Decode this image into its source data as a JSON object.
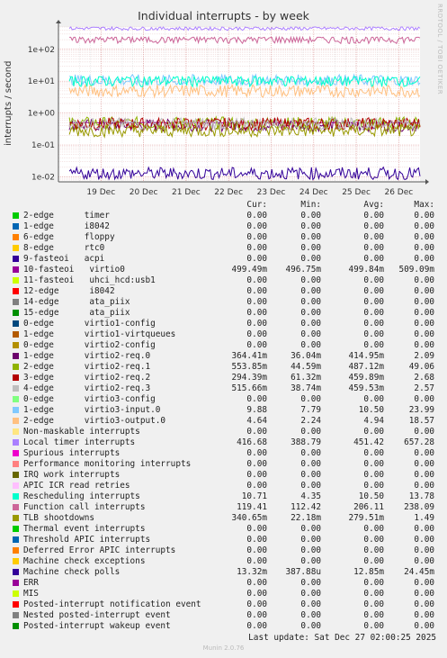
{
  "title": "Individual interrupts - by week",
  "side_text": "RRDTOOL / TOBI OETIKER",
  "footer": "Last update: Sat Dec 27 02:00:25 2025",
  "munin_version": "Munin 2.0.76",
  "legend_headers": {
    "cur": "Cur:",
    "min": "Min:",
    "avg": "Avg:",
    "max": "Max:"
  },
  "chart_data": {
    "type": "line",
    "ylabel": "interrupts / second",
    "yscale": "log",
    "ylim": [
      0.007,
      500
    ],
    "y_ticks": [
      "1e-02",
      "1e-01",
      "1e+00",
      "1e+01",
      "1e+02"
    ],
    "x_ticks": [
      "19 Dec",
      "20 Dec",
      "21 Dec",
      "22 Dec",
      "23 Dec",
      "24 Dec",
      "25 Dec",
      "26 Dec"
    ],
    "grid": true,
    "series": [
      {
        "name": "2-edge      timer",
        "color": "#00cc00",
        "cur": "0.00",
        "min": "0.00",
        "avg": "0.00",
        "max": "0.00"
      },
      {
        "name": "1-edge      i8042",
        "color": "#0066b3",
        "cur": "0.00",
        "min": "0.00",
        "avg": "0.00",
        "max": "0.00"
      },
      {
        "name": "6-edge      floppy",
        "color": "#ff8000",
        "cur": "0.00",
        "min": "0.00",
        "avg": "0.00",
        "max": "0.00"
      },
      {
        "name": "8-edge      rtc0",
        "color": "#ffcc00",
        "cur": "0.00",
        "min": "0.00",
        "avg": "0.00",
        "max": "0.00"
      },
      {
        "name": "9-fasteoi   acpi",
        "color": "#330099",
        "cur": "0.00",
        "min": "0.00",
        "avg": "0.00",
        "max": "0.00"
      },
      {
        "name": "10-fasteoi   virtio0",
        "color": "#990099",
        "cur": "499.49m",
        "min": "496.75m",
        "avg": "499.84m",
        "max": "509.09m"
      },
      {
        "name": "11-fasteoi   uhci_hcd:usb1",
        "color": "#ccff00",
        "cur": "0.00",
        "min": "0.00",
        "avg": "0.00",
        "max": "0.00"
      },
      {
        "name": "12-edge      i8042",
        "color": "#ff0000",
        "cur": "0.00",
        "min": "0.00",
        "avg": "0.00",
        "max": "0.00"
      },
      {
        "name": "14-edge      ata_piix",
        "color": "#808080",
        "cur": "0.00",
        "min": "0.00",
        "avg": "0.00",
        "max": "0.00"
      },
      {
        "name": "15-edge      ata_piix",
        "color": "#008f00",
        "cur": "0.00",
        "min": "0.00",
        "avg": "0.00",
        "max": "0.00"
      },
      {
        "name": "0-edge      virtio1-config",
        "color": "#00487d",
        "cur": "0.00",
        "min": "0.00",
        "avg": "0.00",
        "max": "0.00"
      },
      {
        "name": "1-edge      virtio1-virtqueues",
        "color": "#b35a00",
        "cur": "0.00",
        "min": "0.00",
        "avg": "0.00",
        "max": "0.00"
      },
      {
        "name": "0-edge      virtio2-config",
        "color": "#b38f00",
        "cur": "0.00",
        "min": "0.00",
        "avg": "0.00",
        "max": "0.00"
      },
      {
        "name": "1-edge      virtio2-req.0",
        "color": "#6b006b",
        "cur": "364.41m",
        "min": "36.04m",
        "avg": "414.95m",
        "max": "2.09"
      },
      {
        "name": "2-edge      virtio2-req.1",
        "color": "#8fb300",
        "cur": "553.85m",
        "min": "44.59m",
        "avg": "487.12m",
        "max": "49.06"
      },
      {
        "name": "3-edge      virtio2-req.2",
        "color": "#b30000",
        "cur": "294.39m",
        "min": "61.32m",
        "avg": "459.89m",
        "max": "2.68"
      },
      {
        "name": "4-edge      virtio2-req.3",
        "color": "#bebebe",
        "cur": "515.66m",
        "min": "38.74m",
        "avg": "459.53m",
        "max": "2.57"
      },
      {
        "name": "0-edge      virtio3-config",
        "color": "#80ff80",
        "cur": "0.00",
        "min": "0.00",
        "avg": "0.00",
        "max": "0.00"
      },
      {
        "name": "1-edge      virtio3-input.0",
        "color": "#80c9ff",
        "cur": "9.88",
        "min": "7.79",
        "avg": "10.50",
        "max": "23.99"
      },
      {
        "name": "2-edge      virtio3-output.0",
        "color": "#ffc080",
        "cur": "4.64",
        "min": "2.24",
        "avg": "4.94",
        "max": "18.57"
      },
      {
        "name": "Non-maskable interrupts",
        "color": "#ffe680",
        "cur": "0.00",
        "min": "0.00",
        "avg": "0.00",
        "max": "0.00"
      },
      {
        "name": "Local timer interrupts",
        "color": "#aa80ff",
        "cur": "416.68",
        "min": "388.79",
        "avg": "451.42",
        "max": "657.28"
      },
      {
        "name": "Spurious interrupts",
        "color": "#ee00cc",
        "cur": "0.00",
        "min": "0.00",
        "avg": "0.00",
        "max": "0.00"
      },
      {
        "name": "Performance monitoring interrupts",
        "color": "#ff8080",
        "cur": "0.00",
        "min": "0.00",
        "avg": "0.00",
        "max": "0.00"
      },
      {
        "name": "IRQ work interrupts",
        "color": "#666600",
        "cur": "0.00",
        "min": "0.00",
        "avg": "0.00",
        "max": "0.00"
      },
      {
        "name": "APIC ICR read retries",
        "color": "#ffbfff",
        "cur": "0.00",
        "min": "0.00",
        "avg": "0.00",
        "max": "0.00"
      },
      {
        "name": "Rescheduling interrupts",
        "color": "#00ffcc",
        "cur": "10.71",
        "min": "4.35",
        "avg": "10.50",
        "max": "13.78"
      },
      {
        "name": "Function call interrupts",
        "color": "#cc6699",
        "cur": "119.41",
        "min": "112.42",
        "avg": "206.11",
        "max": "238.09"
      },
      {
        "name": "TLB shootdowns",
        "color": "#999900",
        "cur": "340.65m",
        "min": "22.18m",
        "avg": "279.51m",
        "max": "1.49"
      },
      {
        "name": "Thermal event interrupts",
        "color": "#00cc00",
        "cur": "0.00",
        "min": "0.00",
        "avg": "0.00",
        "max": "0.00"
      },
      {
        "name": "Threshold APIC interrupts",
        "color": "#0066b3",
        "cur": "0.00",
        "min": "0.00",
        "avg": "0.00",
        "max": "0.00"
      },
      {
        "name": "Deferred Error APIC interrupts",
        "color": "#ff8000",
        "cur": "0.00",
        "min": "0.00",
        "avg": "0.00",
        "max": "0.00"
      },
      {
        "name": "Machine check exceptions",
        "color": "#ffcc00",
        "cur": "0.00",
        "min": "0.00",
        "avg": "0.00",
        "max": "0.00"
      },
      {
        "name": "Machine check polls",
        "color": "#330099",
        "cur": "13.32m",
        "min": "387.88u",
        "avg": "12.85m",
        "max": "24.45m"
      },
      {
        "name": "ERR",
        "color": "#990099",
        "cur": "0.00",
        "min": "0.00",
        "avg": "0.00",
        "max": "0.00"
      },
      {
        "name": "MIS",
        "color": "#ccff00",
        "cur": "0.00",
        "min": "0.00",
        "avg": "0.00",
        "max": "0.00"
      },
      {
        "name": "Posted-interrupt notification event",
        "color": "#ff0000",
        "cur": "0.00",
        "min": "0.00",
        "avg": "0.00",
        "max": "0.00"
      },
      {
        "name": "Nested posted-interrupt event",
        "color": "#808080",
        "cur": "0.00",
        "min": "0.00",
        "avg": "0.00",
        "max": "0.00"
      },
      {
        "name": "Posted-interrupt wakeup event",
        "color": "#008f00",
        "cur": "0.00",
        "min": "0.00",
        "avg": "0.00",
        "max": "0.00"
      }
    ]
  }
}
